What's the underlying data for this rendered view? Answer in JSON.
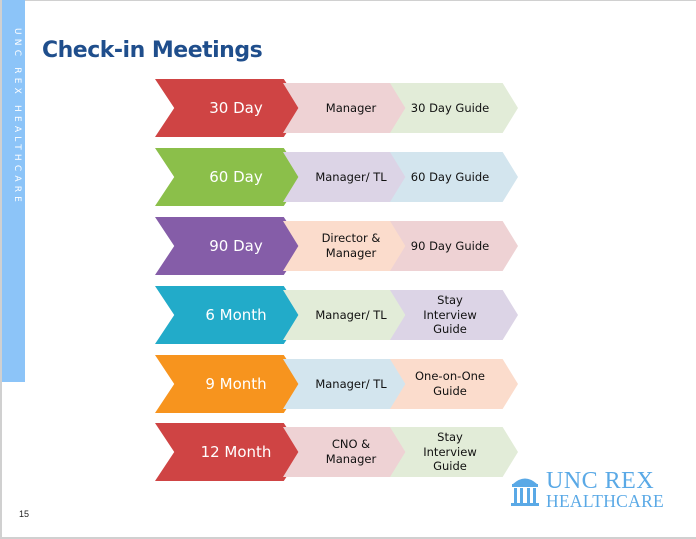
{
  "sidebar": {
    "text": "UNC REX HEALTHCARE",
    "color": "#8cc4f8"
  },
  "title": "Check-in Meetings",
  "rows": [
    {
      "period": "30 Day",
      "who": "Manager",
      "guide": "30 Day Guide",
      "colors": [
        "#cf4444",
        "#eed2d4",
        "#e2ecd8"
      ]
    },
    {
      "period": "60 Day",
      "who": "Manager/ TL",
      "guide": "60 Day Guide",
      "colors": [
        "#8bbf4a",
        "#dcd4e6",
        "#d3e5ee"
      ]
    },
    {
      "period": "90 Day",
      "who": "Director & Manager",
      "guide": "90 Day Guide",
      "colors": [
        "#855da8",
        "#fbdccc",
        "#eed2d4"
      ]
    },
    {
      "period": "6 Month",
      "who": "Manager/ TL",
      "guide": "Stay Interview Guide",
      "colors": [
        "#22abc9",
        "#e2ecd8",
        "#dcd4e6"
      ]
    },
    {
      "period": "9 Month",
      "who": "Manager/ TL",
      "guide": "One-on-One Guide",
      "colors": [
        "#f7941e",
        "#d3e5ee",
        "#fbdccc"
      ]
    },
    {
      "period": "12 Month",
      "who": "CNO & Manager",
      "guide": "Stay Interview Guide",
      "colors": [
        "#cf4444",
        "#eed2d4",
        "#e2ecd8"
      ]
    }
  ],
  "logo": {
    "line1": "UNC REX",
    "line2": "HEALTHCARE",
    "icon": "building-columns-icon",
    "color": "#5aa9e6"
  },
  "page_number": "15"
}
